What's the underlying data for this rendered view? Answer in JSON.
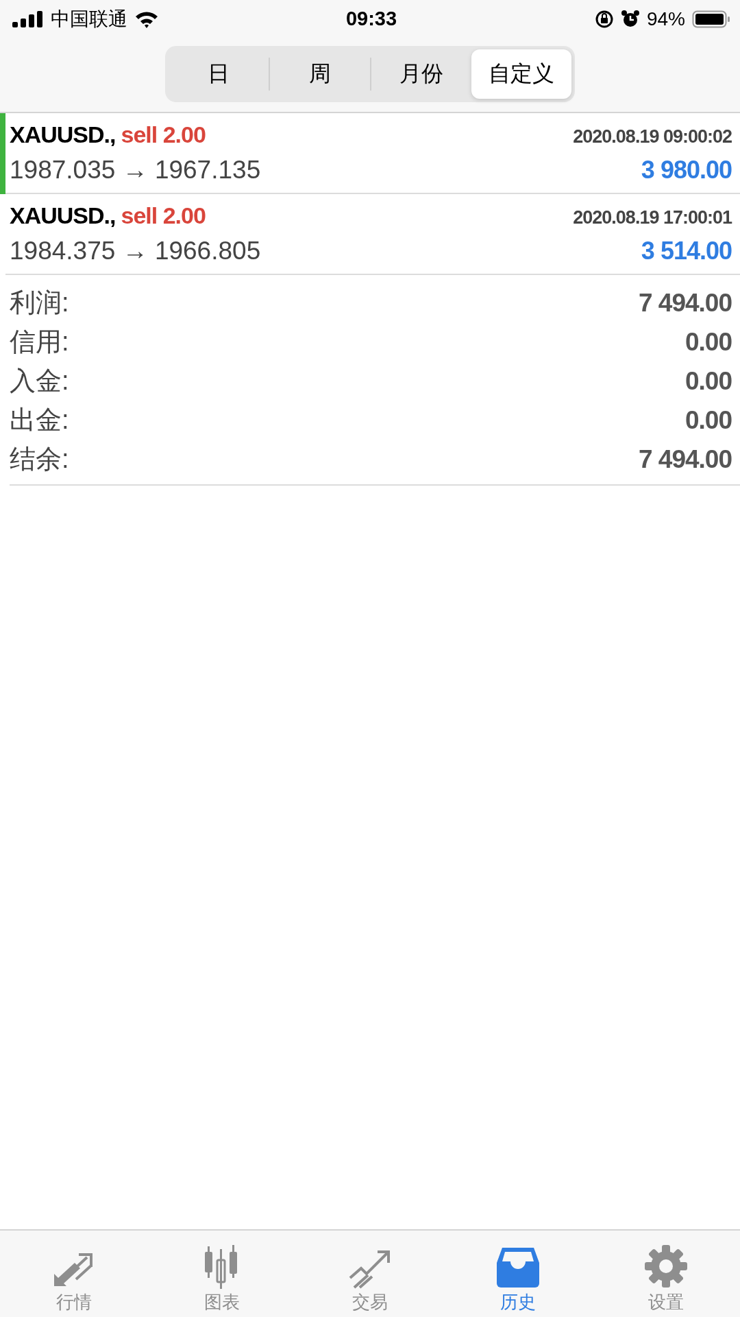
{
  "status_bar": {
    "carrier": "中国联通",
    "time": "09:33",
    "battery": "94%"
  },
  "tabs": [
    {
      "label": "日",
      "selected": false
    },
    {
      "label": "周",
      "selected": false
    },
    {
      "label": "月份",
      "selected": false
    },
    {
      "label": "自定义",
      "selected": true
    }
  ],
  "trades": [
    {
      "symbol": "XAUUSD.,",
      "action": "sell 2.00",
      "time": "2020.08.19 09:00:02",
      "prices": "1987.035 → 1967.135",
      "profit": "3 980.00",
      "selected": true
    },
    {
      "symbol": "XAUUSD.,",
      "action": "sell 2.00",
      "time": "2020.08.19 17:00:01",
      "prices": "1984.375 → 1966.805",
      "profit": "3 514.00",
      "selected": false
    }
  ],
  "summary": [
    {
      "label": "利润:",
      "value": "7 494.00"
    },
    {
      "label": "信用:",
      "value": "0.00"
    },
    {
      "label": "入金:",
      "value": "0.00"
    },
    {
      "label": "出金:",
      "value": "0.00"
    },
    {
      "label": "结余:",
      "value": "7 494.00"
    }
  ],
  "nav": [
    {
      "kind": "quotes",
      "label": "行情",
      "selected": false
    },
    {
      "kind": "chart",
      "label": "图表",
      "selected": false
    },
    {
      "kind": "trade",
      "label": "交易",
      "selected": false
    },
    {
      "kind": "history",
      "label": "历史",
      "selected": true
    },
    {
      "kind": "settings",
      "label": "设置",
      "selected": false
    }
  ]
}
